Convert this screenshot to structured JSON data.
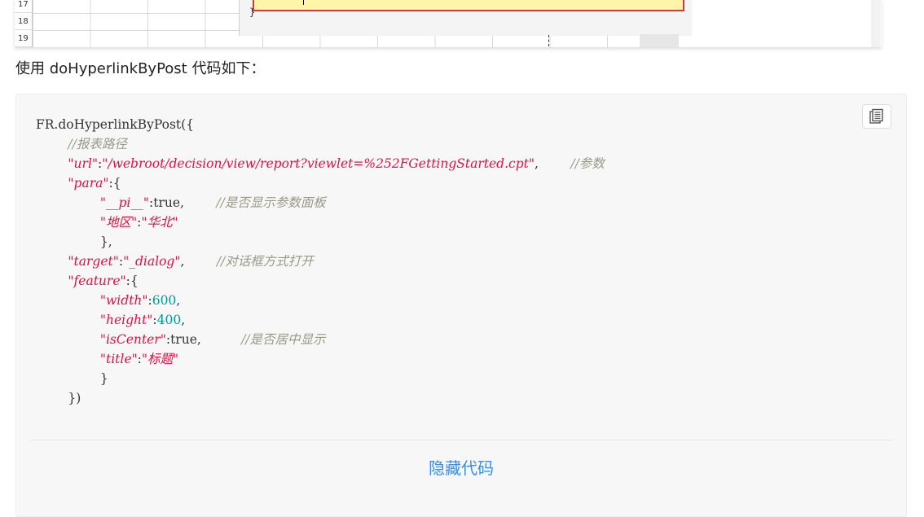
{
  "screenshot": {
    "row_numbers": [
      "17",
      "18",
      "19"
    ]
  },
  "caption": "使用 doHyperlinkByPost 代码如下：",
  "code": {
    "line1": "FR.doHyperlinkByPost({",
    "comment_path": "//报表路径",
    "url_key": "\"url\"",
    "url_value": "\"/webroot/decision/view/report?viewlet=%252FGettingStarted.cpt\"",
    "comment_params": "//参数",
    "para_key": "\"para\"",
    "pi_key": "\"__pi__\"",
    "pi_value": "true",
    "comment_show_panel": "//是否显示参数面板",
    "region_key": "\"地区\"",
    "region_value": "\"华北\"",
    "close_para": "},",
    "target_key": "\"target\"",
    "target_value": "\"_dialog\"",
    "comment_dialog": "//对话框方式打开",
    "feature_key": "\"feature\"",
    "width_key": "\"width\"",
    "width_value": "600",
    "height_key": "\"height\"",
    "height_value": "400",
    "center_key": "\"isCenter\"",
    "center_value": "true",
    "comment_center": "//是否居中显示",
    "title_key": "\"title\"",
    "title_value": "\"标题\"",
    "close_feature": "}",
    "close_call": "})"
  },
  "copy_icon": "copy-icon",
  "toggle_label": "隐藏代码"
}
